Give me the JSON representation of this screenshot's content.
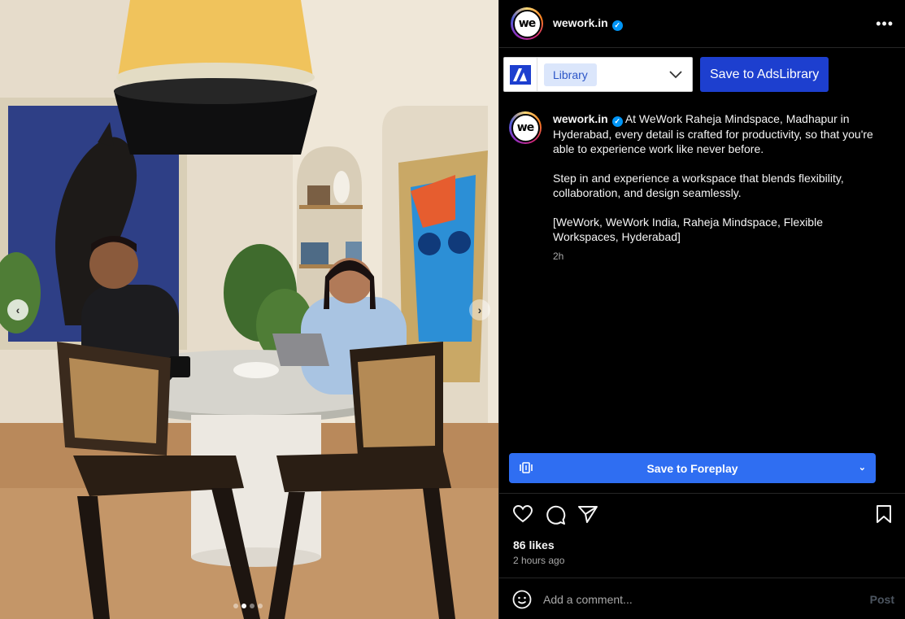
{
  "post": {
    "handle": "wework.in",
    "avatar_text": "we",
    "more_icon": "more-horizontal-icon"
  },
  "toolbar": {
    "library_label": "Library",
    "save_ads_label": "Save to AdsLibrary"
  },
  "caption": {
    "handle": "wework.in",
    "paragraph1": "At WeWork Raheja Mindspace, Madhapur in Hyderabad, every detail is crafted for productivity, so that you're able to experience work like never before.",
    "paragraph2": "Step in and experience a workspace that blends flexibility, collaboration, and design seamlessly.",
    "paragraph3": "[WeWork, WeWork India, Raheja Mindspace, Flexible Workspaces, Hyderabad]",
    "time": "2h"
  },
  "foreplay": {
    "label": "Save to Foreplay"
  },
  "engagement": {
    "likes": "86 likes",
    "posted": "2 hours ago"
  },
  "comment": {
    "placeholder": "Add a comment...",
    "post_label": "Post"
  },
  "carousel": {
    "total": 4,
    "active_index": 1
  },
  "colors": {
    "accent_blue": "#1d3fcf",
    "foreplay_blue": "#2f6ef2",
    "verified_blue": "#0095f6"
  }
}
